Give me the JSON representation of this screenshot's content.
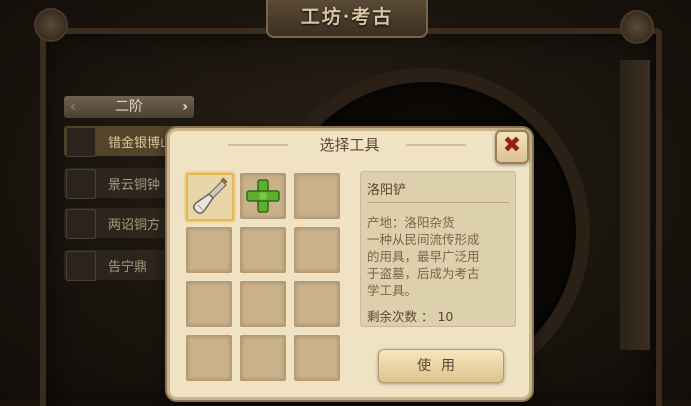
{
  "screen": {
    "title": "工坊·考古"
  },
  "left_panel": {
    "tier_label": "二阶",
    "items": [
      {
        "label": "错金银博山"
      },
      {
        "label": "景云铜钟"
      },
      {
        "label": "两诏铜方"
      },
      {
        "label": "告宁鼎"
      }
    ]
  },
  "dialog": {
    "title": "选择工具",
    "close_glyph": "✖",
    "slots": [
      {
        "icon": "shovel-icon"
      },
      {
        "icon": "plus-icon"
      },
      {
        "icon": ""
      },
      {
        "icon": ""
      },
      {
        "icon": ""
      },
      {
        "icon": ""
      },
      {
        "icon": ""
      },
      {
        "icon": ""
      },
      {
        "icon": ""
      },
      {
        "icon": ""
      },
      {
        "icon": ""
      },
      {
        "icon": ""
      }
    ],
    "info": {
      "name": "洛阳铲",
      "origin": "产地：洛阳杂货",
      "desc_lines": [
        "一种从民间流传形成",
        "的用具，最早广泛用",
        "于盗墓，后成为考古",
        "学工具。"
      ],
      "remaining": "剩余次数 ： 10"
    },
    "use_button": "使用"
  },
  "colors": {
    "dialog_bg": "#efe3c4",
    "selection": "#e9b84a",
    "close_red": "#9b1d12",
    "plus_green": "#5fae2e"
  }
}
